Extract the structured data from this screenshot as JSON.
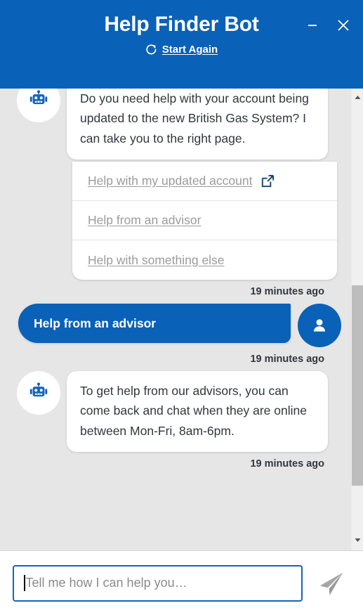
{
  "header": {
    "title": "Help Finder Bot",
    "start_again_label": "Start Again",
    "minimize_label": "−",
    "close_label": "✕",
    "background_color": "#0a61b8"
  },
  "conversation": {
    "messages": [
      {
        "sender": "bot",
        "text": "Do you need help with your account being updated to the new British Gas System? I can take you to the right page."
      },
      {
        "sender": "user",
        "text": "Help from an advisor",
        "timestamp": "19 minutes ago"
      },
      {
        "sender": "bot",
        "text": "To get help from our advisors, you can come back and chat when they are online between Mon-Fri, 8am-6pm.",
        "timestamp": "19 minutes ago"
      }
    ],
    "options": [
      {
        "label": "Help with my updated account",
        "external": true
      },
      {
        "label": "Help from an advisor",
        "external": false
      },
      {
        "label": "Help with something else",
        "external": false
      }
    ],
    "options_timestamp": "19 minutes ago",
    "user_timestamp_above": "19 minutes ago"
  },
  "composer": {
    "placeholder": "Tell me how I can help you…",
    "value": "",
    "send_label": "Send"
  },
  "colors": {
    "brand_blue": "#0a61b8",
    "chat_background": "#e6e6e6",
    "bubble_white": "#ffffff",
    "text_dark": "#32373d",
    "disabled_text": "#9b9b9b",
    "icon_dark_blue": "#17457a",
    "send_gray": "#a6a6a6"
  }
}
